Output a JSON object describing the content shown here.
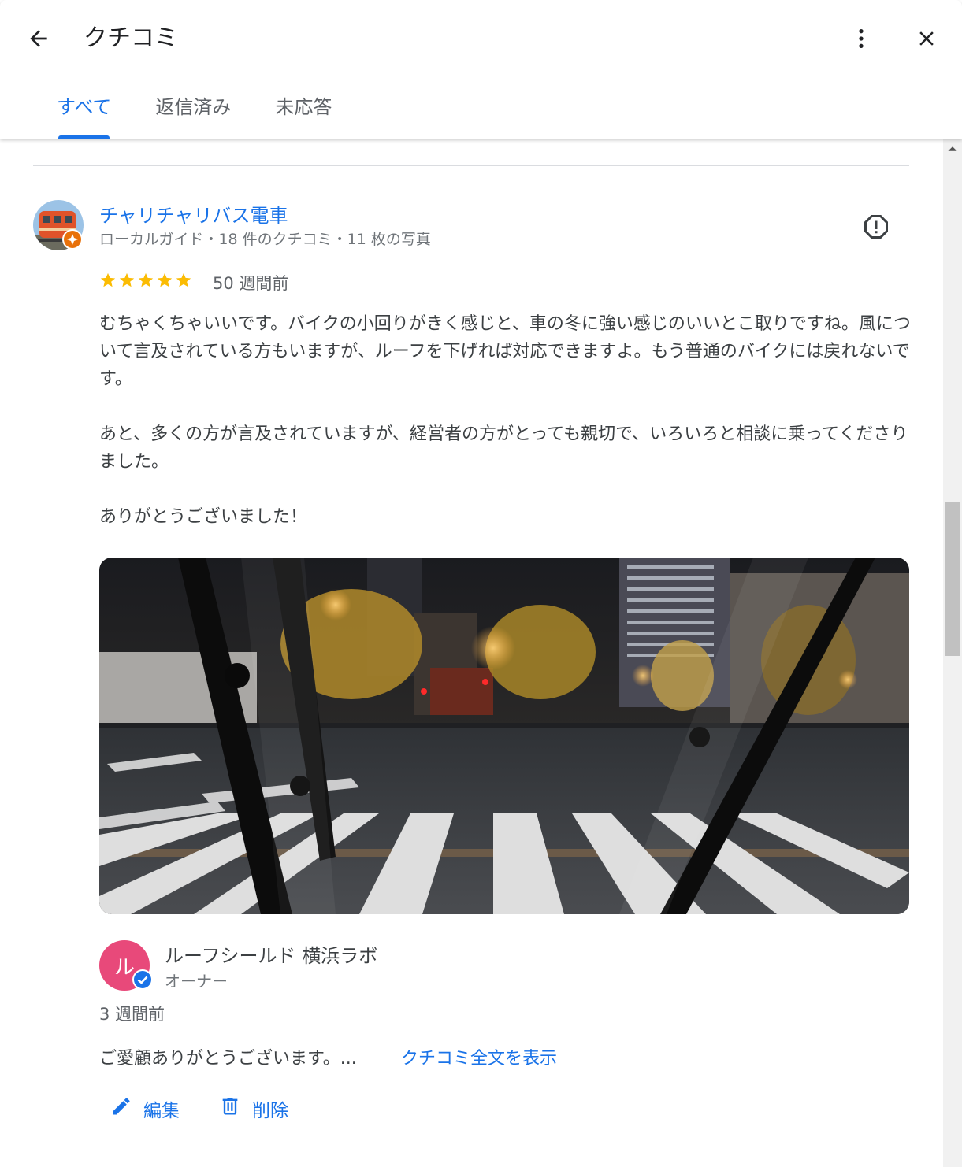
{
  "header": {
    "title": "クチコミ",
    "tabs": [
      {
        "label": "すべて",
        "active": true
      },
      {
        "label": "返信済み",
        "active": false
      },
      {
        "label": "未応答",
        "active": false
      }
    ],
    "icons": {
      "back": "arrow-back-icon",
      "more": "more-vert-icon",
      "close": "close-icon"
    }
  },
  "review": {
    "reviewer_name": "チャリチャリバス電車",
    "reviewer_meta": "ローカルガイド・18 件のクチコミ・11 枚の写真",
    "rating": 5,
    "time": "50 週間前",
    "text": "むちゃくちゃいいです。バイクの小回りがきく感じと、車の冬に強い感じのいいとこ取りですね。風について言及されている方もいますが、ルーフを下げれば対応できますよ。もう普通のバイクには戻れないです。\n\nあと、多くの方が言及されていますが、経営者の方がとっても親切で、いろいろと相談に乗ってくださりました。\n\nありがとうございました！",
    "icons": {
      "report": "report-icon",
      "star": "star-icon",
      "guide_badge": "local-guide-badge-icon"
    }
  },
  "owner_reply": {
    "avatar_letter": "ル",
    "name": "ルーフシールド 横浜ラボ",
    "role": "オーナー",
    "time": "3 週間前",
    "text": "ご愛顧ありがとうございます。...",
    "more_link": "クチコミ全文を表示"
  },
  "actions": {
    "edit_label": "編集",
    "delete_label": "削除"
  },
  "colors": {
    "accent": "#1a73e8",
    "star": "#fbbc04",
    "owner_avatar": "#e8497a",
    "guide_badge": "#e8710a"
  }
}
